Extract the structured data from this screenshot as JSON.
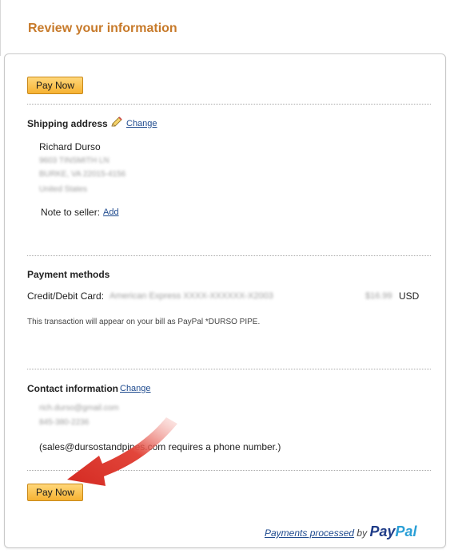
{
  "header": {
    "title": "Review your information"
  },
  "buttons": {
    "pay_now_top": "Pay Now",
    "pay_now_bottom": "Pay Now"
  },
  "shipping": {
    "title": "Shipping address",
    "change_label": "Change",
    "name": "Richard Durso",
    "street": "9603 TINSMITH LN",
    "city": "BURKE, VA 22015-4156",
    "country": "United States",
    "note_label": "Note to seller:",
    "note_add": "Add"
  },
  "payment": {
    "title": "Payment methods",
    "card_label": "Credit/Debit Card:",
    "card_number": "American Express XXXX-XXXXXX-X2003",
    "amount": "$16.99",
    "currency": "USD",
    "bill_note": "This transaction will appear on your bill as PayPal *DURSO PIPE."
  },
  "contact": {
    "title": "Contact information",
    "change_label": "Change",
    "email": "rich.durso@gmail.com",
    "phone": "845-380-2236",
    "phone_required": "(sales@dursostandpipes.com requires a phone number.)"
  },
  "footer": {
    "processed_label": "Payments processed",
    "by": "by",
    "logo_part1": "Pay",
    "logo_part2": "Pal"
  },
  "colors": {
    "title": "#c77a2a",
    "link": "#1e4a8e",
    "button": "#f6b232",
    "arrow": "#d9302a"
  },
  "icons": {
    "edit": "pencil-icon",
    "pointer": "red-arrow-icon"
  }
}
